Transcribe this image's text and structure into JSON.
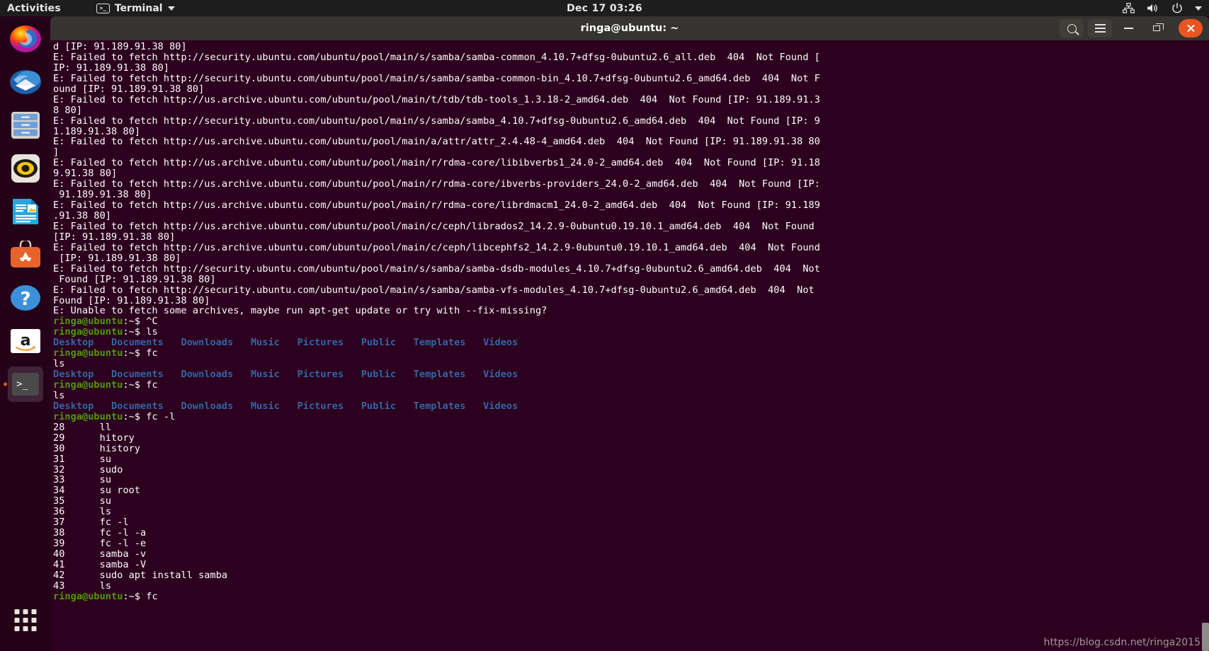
{
  "top_bar": {
    "activities": "Activities",
    "app_name": "Terminal",
    "app_icon": "terminal-icon",
    "clock": "Dec 17  03:26",
    "tray": [
      "network-icon",
      "volume-icon",
      "power-icon",
      "chevron-down-icon"
    ]
  },
  "dock": {
    "items": [
      {
        "name": "firefox",
        "label": "Firefox",
        "active": false
      },
      {
        "name": "thunderbird",
        "label": "Thunderbird Mail",
        "active": false
      },
      {
        "name": "files",
        "label": "Files",
        "active": false
      },
      {
        "name": "rhythmbox",
        "label": "Rhythmbox",
        "active": false
      },
      {
        "name": "libreoffice-writer",
        "label": "LibreOffice Writer",
        "active": false
      },
      {
        "name": "ubuntu-software",
        "label": "Ubuntu Software",
        "active": false
      },
      {
        "name": "help",
        "label": "Help",
        "active": false
      },
      {
        "name": "amazon",
        "label": "Amazon",
        "active": false
      },
      {
        "name": "terminal",
        "label": "Terminal",
        "active": true
      }
    ],
    "show_apps_label": "Show Applications"
  },
  "window": {
    "title": "ringa@ubuntu: ~",
    "buttons": {
      "search": "search-icon",
      "menu": "hamburger-menu-icon",
      "minimize": "minimize-icon",
      "maximize": "restore-icon",
      "close": "close-icon"
    }
  },
  "watermark": "https://blog.csdn.net/ringa2015",
  "colors": {
    "background": "#2c001e",
    "titlebar": "#363430",
    "topbar": "#1d1d1d",
    "prompt_green": "#4e9a06",
    "dir_blue": "#3465a4",
    "text_white": "#ffffff",
    "accent_orange": "#e95420"
  },
  "terminal": {
    "prompt": "ringa@ubuntu:~$ ",
    "lines": [
      {
        "type": "out",
        "text": "d [IP: 91.189.91.38 80]"
      },
      {
        "type": "out",
        "text": "E: Failed to fetch http://security.ubuntu.com/ubuntu/pool/main/s/samba/samba-common_4.10.7+dfsg-0ubuntu2.6_all.deb  404  Not Found ["
      },
      {
        "type": "out",
        "text": "IP: 91.189.91.38 80]"
      },
      {
        "type": "out",
        "text": "E: Failed to fetch http://security.ubuntu.com/ubuntu/pool/main/s/samba/samba-common-bin_4.10.7+dfsg-0ubuntu2.6_amd64.deb  404  Not F"
      },
      {
        "type": "out",
        "text": "ound [IP: 91.189.91.38 80]"
      },
      {
        "type": "out",
        "text": "E: Failed to fetch http://us.archive.ubuntu.com/ubuntu/pool/main/t/tdb/tdb-tools_1.3.18-2_amd64.deb  404  Not Found [IP: 91.189.91.3"
      },
      {
        "type": "out",
        "text": "8 80]"
      },
      {
        "type": "out",
        "text": "E: Failed to fetch http://security.ubuntu.com/ubuntu/pool/main/s/samba/samba_4.10.7+dfsg-0ubuntu2.6_amd64.deb  404  Not Found [IP: 9"
      },
      {
        "type": "out",
        "text": "1.189.91.38 80]"
      },
      {
        "type": "out",
        "text": "E: Failed to fetch http://us.archive.ubuntu.com/ubuntu/pool/main/a/attr/attr_2.4.48-4_amd64.deb  404  Not Found [IP: 91.189.91.38 80"
      },
      {
        "type": "out",
        "text": "]"
      },
      {
        "type": "out",
        "text": "E: Failed to fetch http://us.archive.ubuntu.com/ubuntu/pool/main/r/rdma-core/libibverbs1_24.0-2_amd64.deb  404  Not Found [IP: 91.18"
      },
      {
        "type": "out",
        "text": "9.91.38 80]"
      },
      {
        "type": "out",
        "text": "E: Failed to fetch http://us.archive.ubuntu.com/ubuntu/pool/main/r/rdma-core/ibverbs-providers_24.0-2_amd64.deb  404  Not Found [IP:"
      },
      {
        "type": "out",
        "text": " 91.189.91.38 80]"
      },
      {
        "type": "out",
        "text": "E: Failed to fetch http://us.archive.ubuntu.com/ubuntu/pool/main/r/rdma-core/librdmacm1_24.0-2_amd64.deb  404  Not Found [IP: 91.189"
      },
      {
        "type": "out",
        "text": ".91.38 80]"
      },
      {
        "type": "out",
        "text": "E: Failed to fetch http://us.archive.ubuntu.com/ubuntu/pool/main/c/ceph/librados2_14.2.9-0ubuntu0.19.10.1_amd64.deb  404  Not Found"
      },
      {
        "type": "out",
        "text": "[IP: 91.189.91.38 80]"
      },
      {
        "type": "out",
        "text": "E: Failed to fetch http://us.archive.ubuntu.com/ubuntu/pool/main/c/ceph/libcephfs2_14.2.9-0ubuntu0.19.10.1_amd64.deb  404  Not Found"
      },
      {
        "type": "out",
        "text": " [IP: 91.189.91.38 80]"
      },
      {
        "type": "out",
        "text": "E: Failed to fetch http://security.ubuntu.com/ubuntu/pool/main/s/samba/samba-dsdb-modules_4.10.7+dfsg-0ubuntu2.6_amd64.deb  404  Not"
      },
      {
        "type": "out",
        "text": " Found [IP: 91.189.91.38 80]"
      },
      {
        "type": "out",
        "text": "E: Failed to fetch http://security.ubuntu.com/ubuntu/pool/main/s/samba/samba-vfs-modules_4.10.7+dfsg-0ubuntu2.6_amd64.deb  404  Not"
      },
      {
        "type": "out",
        "text": "Found [IP: 91.189.91.38 80]"
      },
      {
        "type": "out",
        "text": "E: Unable to fetch some archives, maybe run apt-get update or try with --fix-missing?"
      },
      {
        "type": "cmd",
        "text": "^C"
      },
      {
        "type": "cmd",
        "text": "ls"
      },
      {
        "type": "dirs",
        "text": "Desktop   Documents   Downloads   Music   Pictures   Public   Templates   Videos"
      },
      {
        "type": "cmd",
        "text": "fc"
      },
      {
        "type": "out",
        "text": "ls"
      },
      {
        "type": "dirs",
        "text": "Desktop   Documents   Downloads   Music   Pictures   Public   Templates   Videos"
      },
      {
        "type": "cmd",
        "text": "fc"
      },
      {
        "type": "out",
        "text": "ls"
      },
      {
        "type": "dirs",
        "text": "Desktop   Documents   Downloads   Music   Pictures   Public   Templates   Videos"
      },
      {
        "type": "cmd",
        "text": "fc -l"
      },
      {
        "type": "out",
        "text": "28      ll"
      },
      {
        "type": "out",
        "text": "29      hitory"
      },
      {
        "type": "out",
        "text": "30      history"
      },
      {
        "type": "out",
        "text": "31      su"
      },
      {
        "type": "out",
        "text": "32      sudo"
      },
      {
        "type": "out",
        "text": "33      su"
      },
      {
        "type": "out",
        "text": "34      su root"
      },
      {
        "type": "out",
        "text": "35      su"
      },
      {
        "type": "out",
        "text": "36      ls"
      },
      {
        "type": "out",
        "text": "37      fc -l"
      },
      {
        "type": "out",
        "text": "38      fc -l -a"
      },
      {
        "type": "out",
        "text": "39      fc -l -e"
      },
      {
        "type": "out",
        "text": "40      samba -v"
      },
      {
        "type": "out",
        "text": "41      samba -V"
      },
      {
        "type": "out",
        "text": "42      sudo apt install samba"
      },
      {
        "type": "out",
        "text": "43      ls"
      },
      {
        "type": "cmd",
        "text": "fc"
      }
    ]
  }
}
